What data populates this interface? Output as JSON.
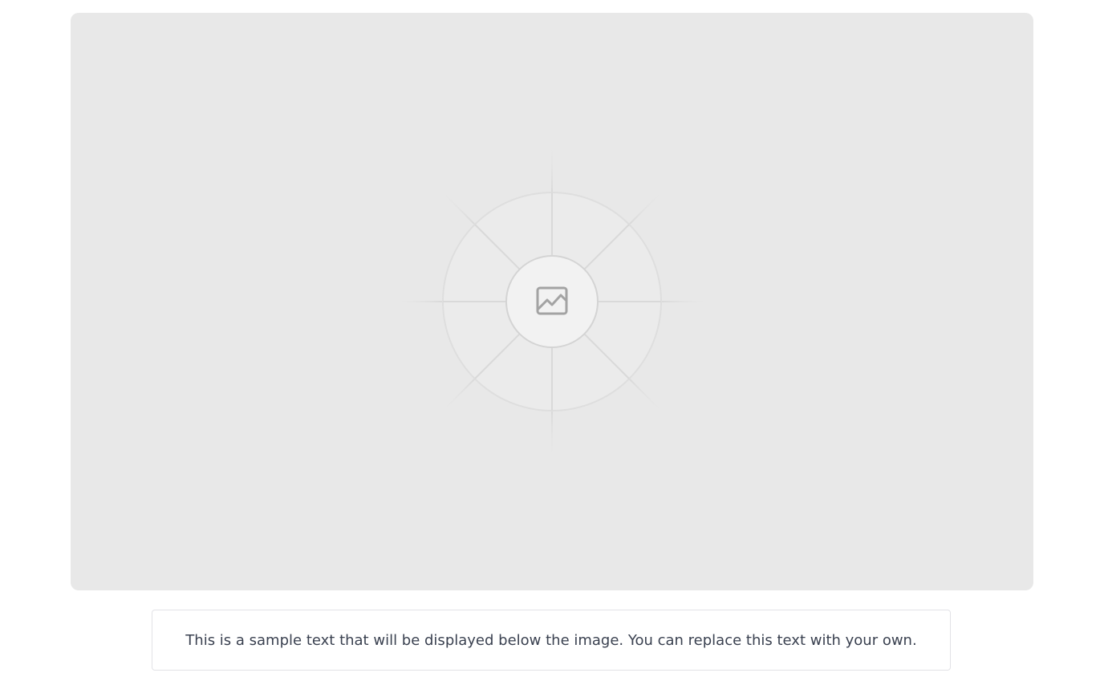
{
  "image": {
    "icon": "image-icon",
    "background_color": "#e8e8e8"
  },
  "caption": {
    "text": "This is a sample text that will be displayed below the image. You can replace this text with your own."
  }
}
